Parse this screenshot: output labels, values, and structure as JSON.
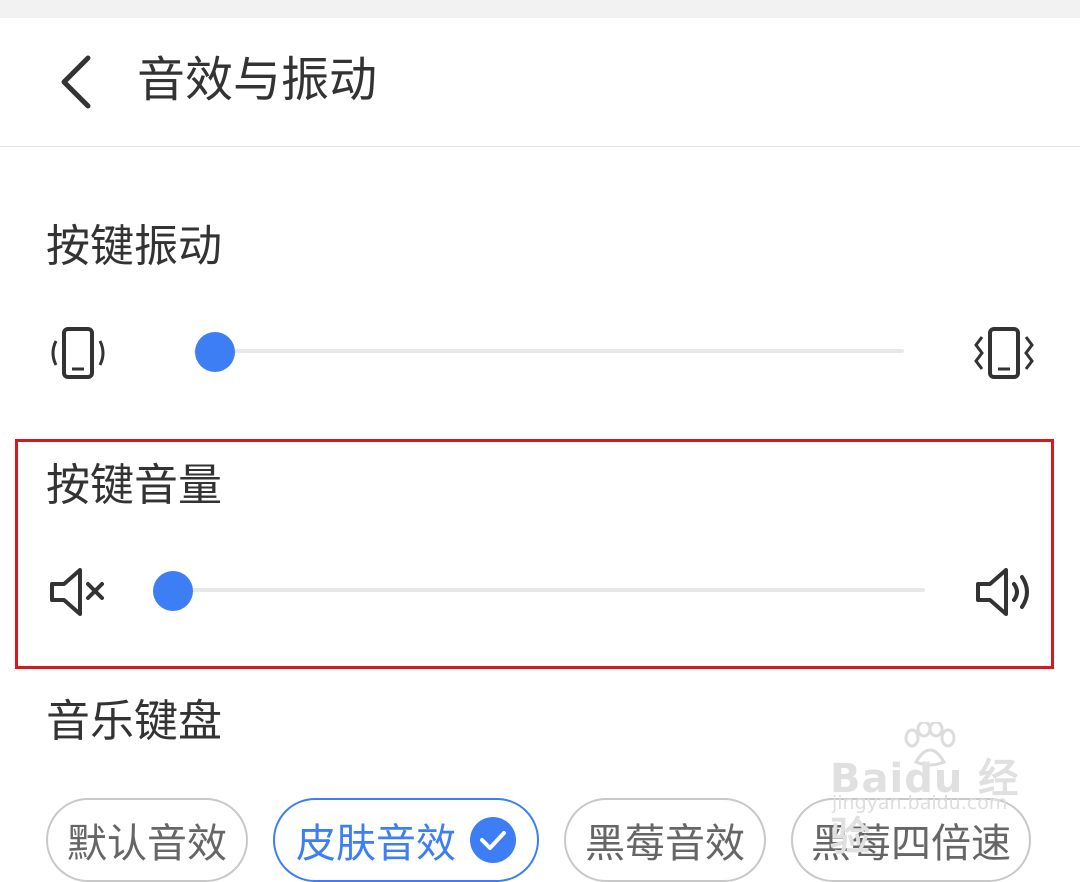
{
  "header": {
    "title": "音效与振动",
    "back_icon": "chevron-left-icon"
  },
  "sections": {
    "vibration": {
      "title": "按键振动",
      "min_icon": "vibrate-low-icon",
      "max_icon": "vibrate-high-icon",
      "level": 0.03
    },
    "volume": {
      "title": "按键音量",
      "min_icon": "volume-mute-icon",
      "max_icon": "volume-high-icon",
      "level": 0.0
    },
    "music_keyboard": {
      "title": "音乐键盘",
      "options": [
        {
          "label": "默认音效",
          "selected": false
        },
        {
          "label": "皮肤音效",
          "selected": true
        },
        {
          "label": "黑莓音效",
          "selected": false
        },
        {
          "label": "黑莓四倍速",
          "selected": false
        }
      ]
    }
  },
  "watermark": {
    "main": "Baidu 经验",
    "sub": "jingyan.baidu.com"
  },
  "colors": {
    "accent": "#3d7ef5",
    "highlight_border": "#d9181e",
    "text": "#333333",
    "track": "#e8e8e8"
  }
}
